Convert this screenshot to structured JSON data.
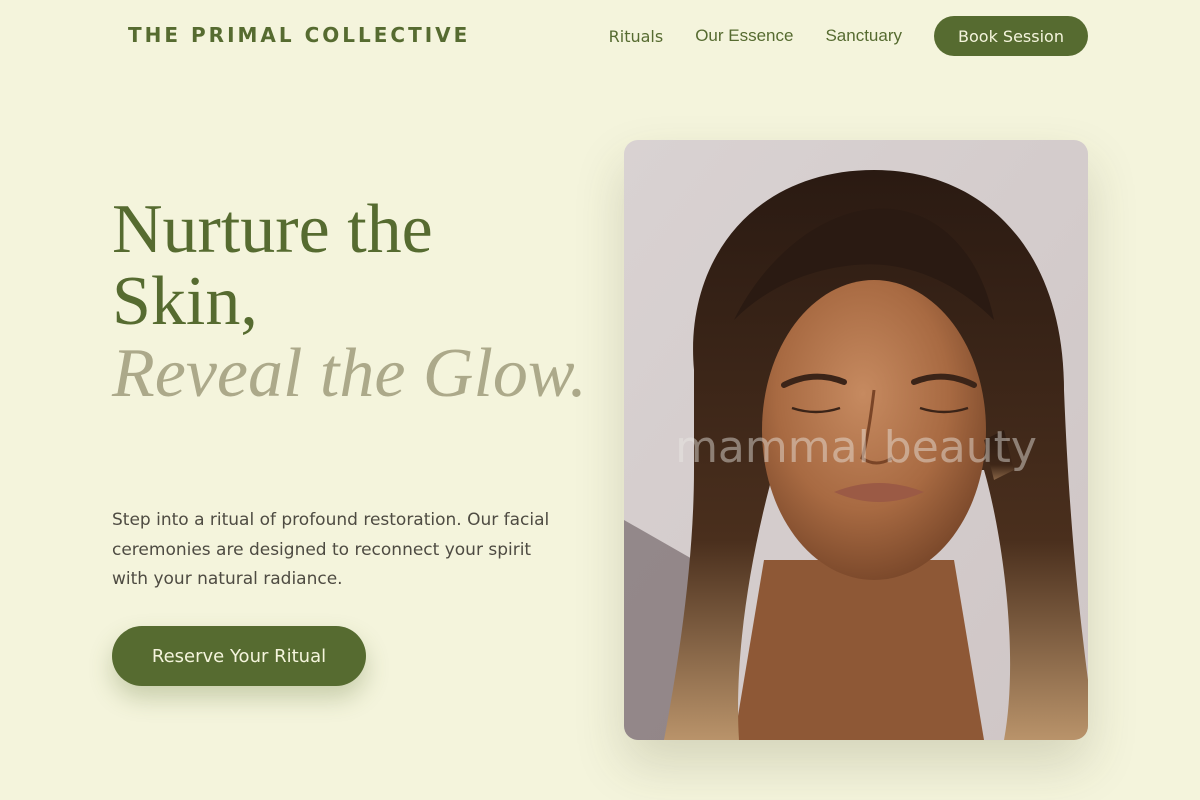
{
  "brand": {
    "name": "THE PRIMAL COLLECTIVE"
  },
  "nav": {
    "links": [
      "Rituals",
      "Our Essence",
      "Sanctuary"
    ],
    "cta_label": "Book Session"
  },
  "hero": {
    "headline_line1": "Nurture the Skin,",
    "headline_line2": "Reveal the Glow.",
    "intro": "Step into a ritual of profound restoration. Our facial ceremonies are designed to reconnect your spirit with your natural radiance.",
    "cta_label": "Reserve Your Ritual",
    "image_watermark": "mammal beauty"
  },
  "colors": {
    "background": "#f4f4dc",
    "brand_green": "#566b30",
    "muted_olive": "#aca98a",
    "body_text": "#4e4b42"
  },
  "icons": {
    "hero_image": "portrait-photo"
  }
}
